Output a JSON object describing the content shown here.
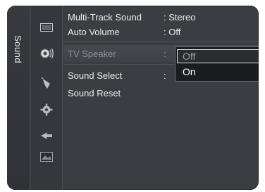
{
  "side_tab": {
    "label": "Sound"
  },
  "icons": [
    "picture-icon",
    "sound-icon",
    "channel-icon",
    "setup-icon",
    "input-icon",
    "application-icon"
  ],
  "menu": {
    "items": [
      {
        "label": "Multi-Track Sound",
        "value": ": Stereo"
      },
      {
        "label": "Auto Volume",
        "value": ": Off"
      },
      {
        "label": "TV Speaker",
        "value": ":"
      },
      {
        "label": "Sound Select",
        "value": ":"
      },
      {
        "label": "Sound Reset",
        "value": ""
      }
    ]
  },
  "dropdown": {
    "selected": "Off",
    "options": [
      "Off",
      "On"
    ]
  },
  "colors": {
    "panel": "#3a3d42",
    "text": "#eeeeee",
    "dim_text": "#8e9196",
    "dropdown_bg": "#1a1c1f"
  }
}
